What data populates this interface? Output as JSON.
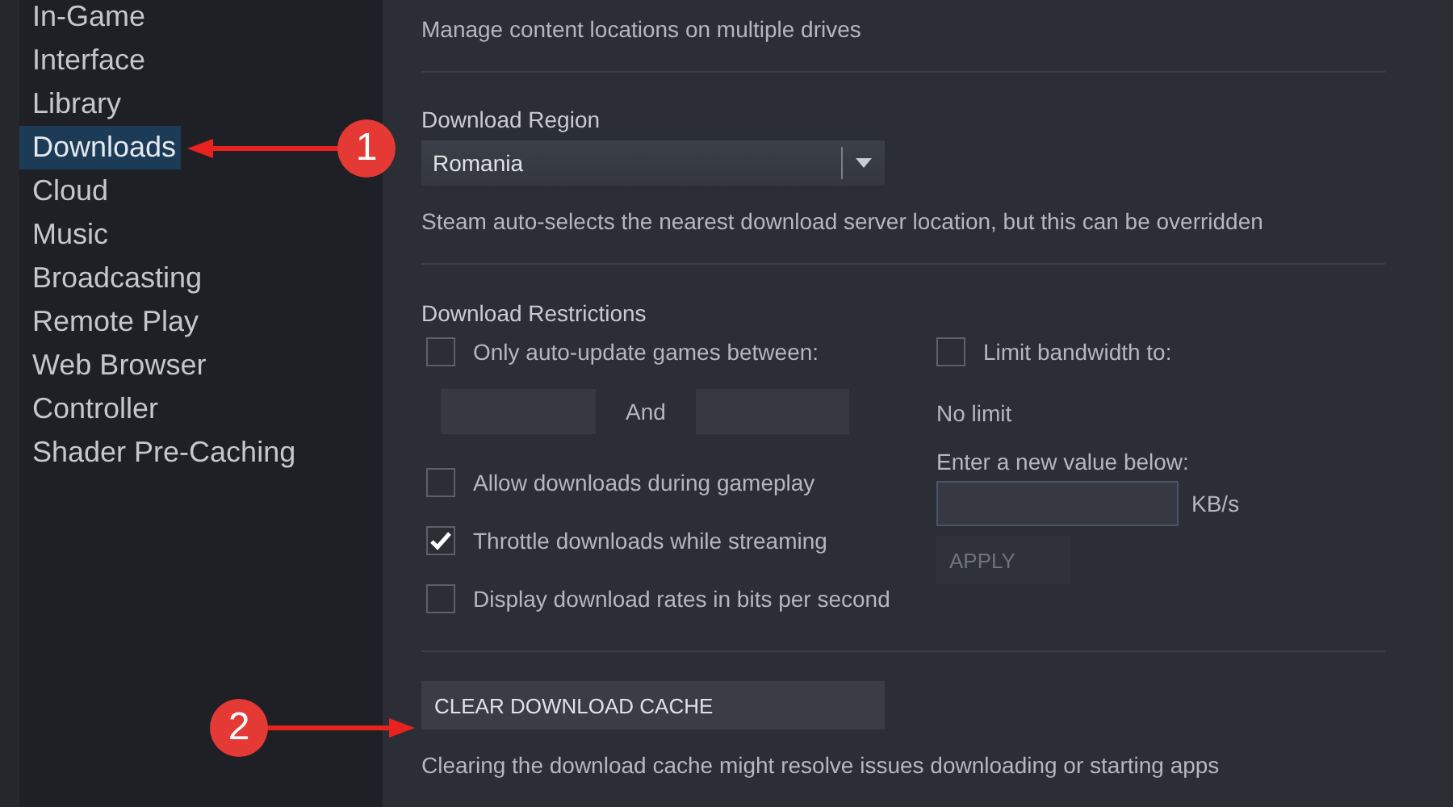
{
  "sidebar": {
    "items": [
      {
        "label": "In-Game",
        "selected": false
      },
      {
        "label": "Interface",
        "selected": false
      },
      {
        "label": "Library",
        "selected": false
      },
      {
        "label": "Downloads",
        "selected": true
      },
      {
        "label": "Cloud",
        "selected": false
      },
      {
        "label": "Music",
        "selected": false
      },
      {
        "label": "Broadcasting",
        "selected": false
      },
      {
        "label": "Remote Play",
        "selected": false
      },
      {
        "label": "Web Browser",
        "selected": false
      },
      {
        "label": "Controller",
        "selected": false
      },
      {
        "label": "Shader Pre-Caching",
        "selected": false
      }
    ]
  },
  "content_libraries": {
    "description": "Manage content locations on multiple drives"
  },
  "download_region": {
    "heading": "Download Region",
    "value": "Romania",
    "description": "Steam auto-selects the nearest download server location, but this can be overridden"
  },
  "download_restrictions": {
    "heading": "Download Restrictions",
    "auto_update": {
      "label": "Only auto-update games between:",
      "checked": false,
      "separator": "And"
    },
    "options": [
      {
        "label": "Allow downloads during gameplay",
        "checked": false
      },
      {
        "label": "Throttle downloads while streaming",
        "checked": true
      },
      {
        "label": "Display download rates in bits per second",
        "checked": false
      }
    ],
    "bandwidth": {
      "label": "Limit bandwidth to:",
      "checked": false,
      "current": "No limit",
      "prompt": "Enter a new value below:",
      "unit": "KB/s",
      "apply_button": "APPLY"
    }
  },
  "clear_cache": {
    "button": "CLEAR DOWNLOAD CACHE",
    "description": "Clearing the download cache might resolve issues downloading or starting apps"
  },
  "annotations": [
    {
      "label": "1"
    },
    {
      "label": "2"
    }
  ]
}
